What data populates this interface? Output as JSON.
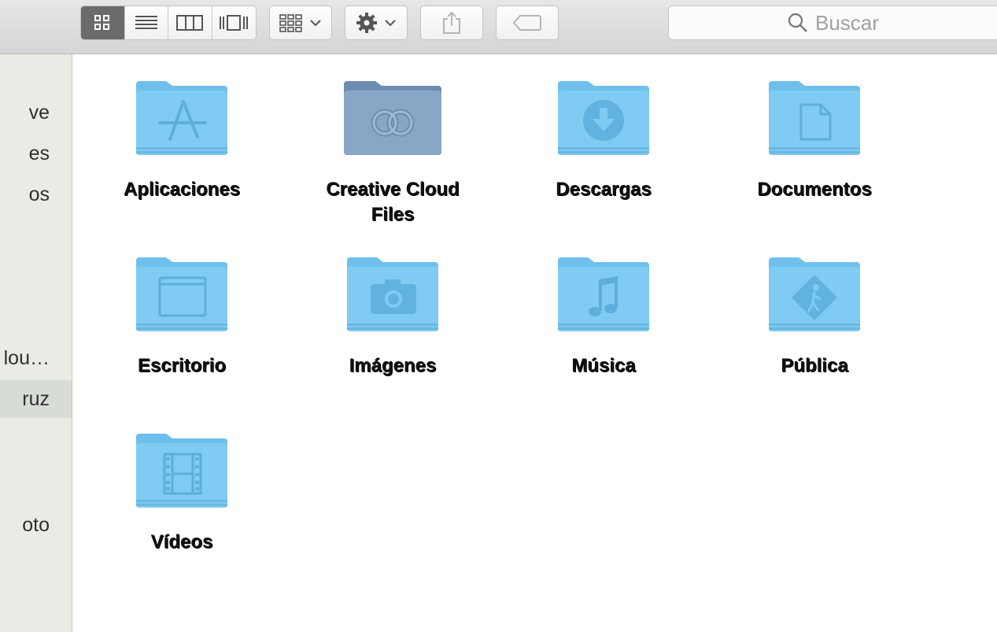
{
  "toolbar": {
    "view_modes": [
      {
        "name": "icon-view",
        "icon": "grid-icon",
        "active": true
      },
      {
        "name": "list-view",
        "icon": "list-icon",
        "active": false
      },
      {
        "name": "column-view",
        "icon": "columns-icon",
        "active": false
      },
      {
        "name": "coverflow-view",
        "icon": "coverflow-icon",
        "active": false
      }
    ],
    "arrange_icon": "arrange-grid-icon",
    "action_icon": "gear-icon",
    "share_icon": "share-icon",
    "tag_icon": "tag-icon",
    "search_placeholder": "Buscar"
  },
  "sidebar": {
    "items": [
      {
        "label": "ve"
      },
      {
        "label": "es"
      },
      {
        "label": "os"
      },
      {
        "label": "lou…"
      },
      {
        "label": "ruz",
        "selected": true
      },
      {
        "label": "oto"
      }
    ]
  },
  "files": [
    {
      "label": "Aplicaciones",
      "icon": "applications-folder-icon"
    },
    {
      "label": "Creative Cloud Files",
      "icon": "creative-cloud-folder-icon"
    },
    {
      "label": "Descargas",
      "icon": "downloads-folder-icon"
    },
    {
      "label": "Documentos",
      "icon": "documents-folder-icon"
    },
    {
      "label": "Escritorio",
      "icon": "desktop-folder-icon"
    },
    {
      "label": "Imágenes",
      "icon": "pictures-folder-icon"
    },
    {
      "label": "Música",
      "icon": "music-folder-icon"
    },
    {
      "label": "Pública",
      "icon": "public-folder-icon"
    },
    {
      "label": "Vídeos",
      "icon": "movies-folder-icon"
    }
  ],
  "colors": {
    "folder": "#7cc9f2",
    "folder_dark": "#5fb3e2",
    "creative_cloud_folder": "#7f9fc0"
  }
}
